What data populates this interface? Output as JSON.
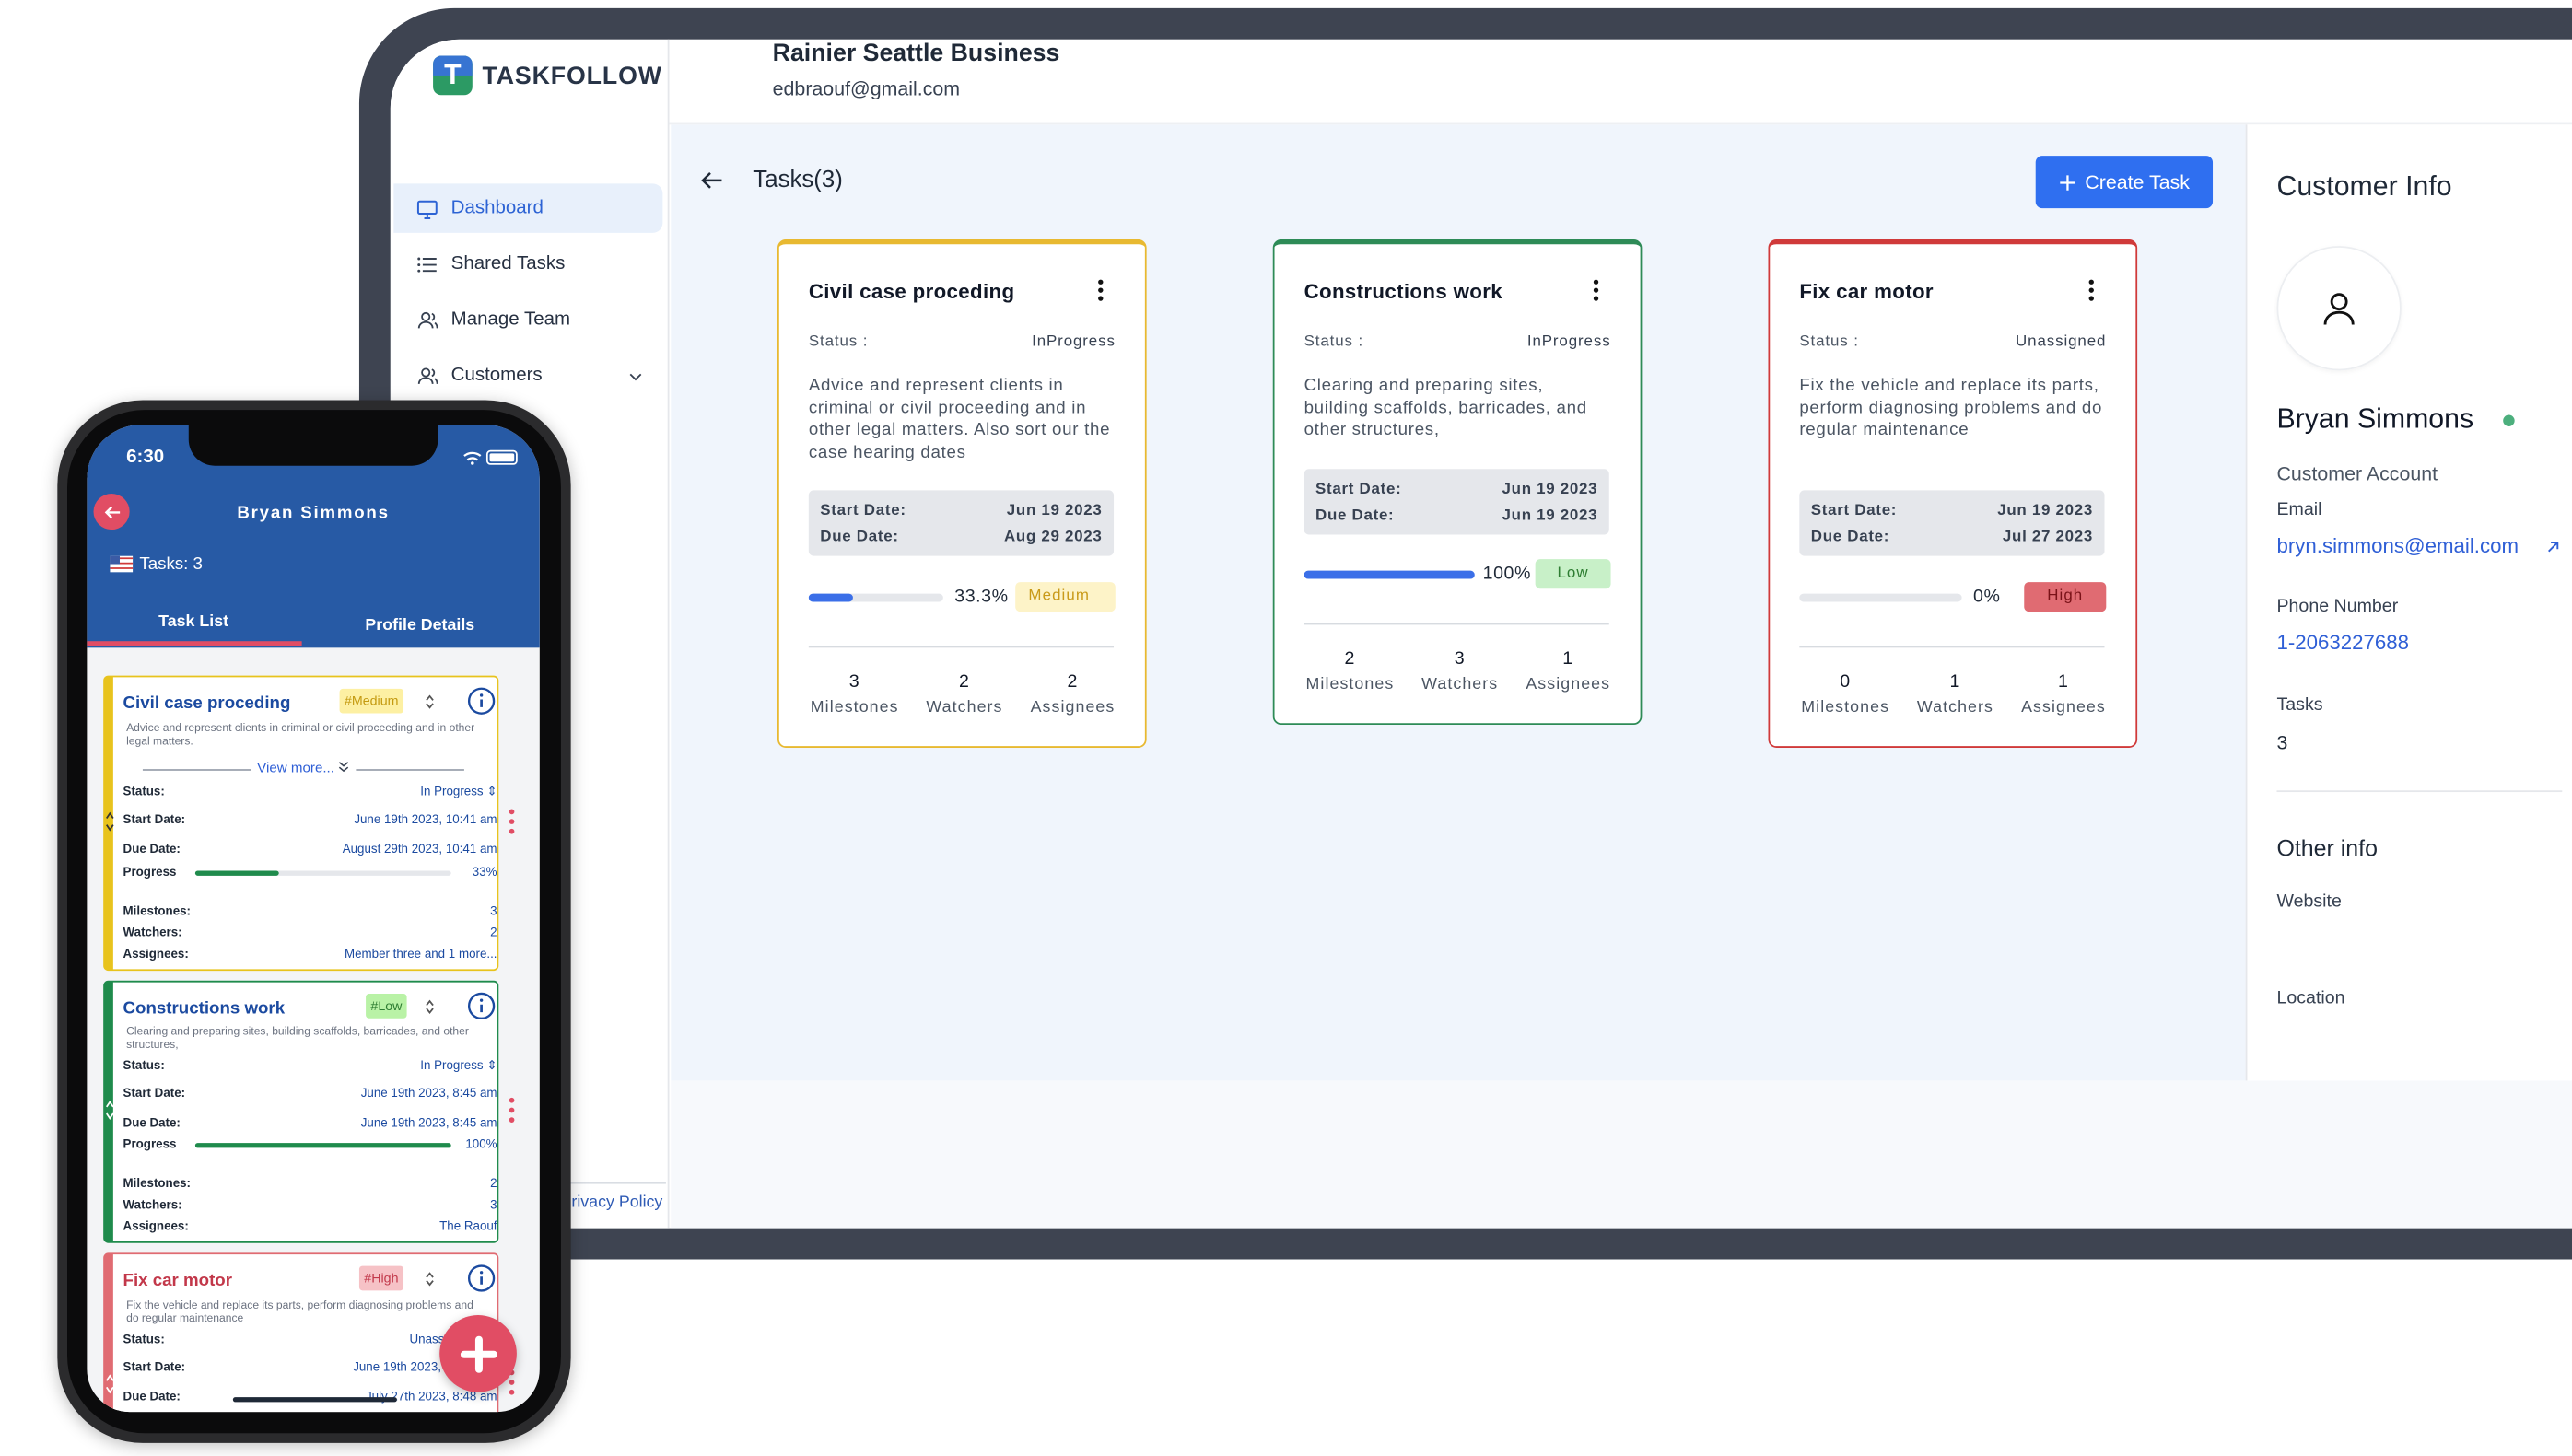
{
  "app": {
    "logo_text": "TASKFOLLOW",
    "business_name": "Rainier Seattle Business",
    "business_email": "edbraouf@gmail.com"
  },
  "sidebar": {
    "items": [
      {
        "label": "Dashboard",
        "icon": "monitor-icon",
        "active": true
      },
      {
        "label": "Shared Tasks",
        "icon": "list-icon"
      },
      {
        "label": "Manage Team",
        "icon": "users-icon"
      },
      {
        "label": "Customers",
        "icon": "users-icon",
        "has_chevron": true
      }
    ],
    "privacy_label": "Privacy Policy"
  },
  "main": {
    "title": "Tasks(3)",
    "create_label": "Create Task"
  },
  "tasks": [
    {
      "title": "Civil case proceding",
      "status_label": "Status :",
      "status": "InProgress",
      "description": "Advice and represent clients in criminal or civil proceeding and in other legal matters. Also sort our the case hearing dates",
      "start_label": "Start Date:",
      "start": "Jun 19 2023",
      "due_label": "Due Date:",
      "due": "Aug 29 2023",
      "progress": 33.3,
      "progress_text": "33.3%",
      "priority": "Medium",
      "milestones": "3",
      "watchers": "2",
      "assignees": "2",
      "milestones_label": "Milestones",
      "watchers_label": "Watchers",
      "assignees_label": "Assignees",
      "accent": "#e8b931"
    },
    {
      "title": "Constructions work",
      "status_label": "Status :",
      "status": "InProgress",
      "description": "Clearing and preparing sites, building scaffolds, barricades, and other structures,",
      "start_label": "Start Date:",
      "start": "Jun 19 2023",
      "due_label": "Due Date:",
      "due": "Jun 19 2023",
      "progress": 100,
      "progress_text": "100%",
      "priority": "Low",
      "milestones": "2",
      "watchers": "3",
      "assignees": "1",
      "milestones_label": "Milestones",
      "watchers_label": "Watchers",
      "assignees_label": "Assignees",
      "accent": "#2e8b57"
    },
    {
      "title": "Fix car motor",
      "status_label": "Status :",
      "status": "Unassigned",
      "description": "Fix the vehicle and replace its parts, perform diagnosing problems and do regular maintenance",
      "start_label": "Start Date:",
      "start": "Jun 19 2023",
      "due_label": "Due Date:",
      "due": "Jul 27 2023",
      "progress": 0,
      "progress_text": "0%",
      "priority": "High",
      "milestones": "0",
      "watchers": "1",
      "assignees": "1",
      "milestones_label": "Milestones",
      "watchers_label": "Watchers",
      "assignees_label": "Assignees",
      "accent": "#d03a3a"
    }
  ],
  "customer": {
    "title": "Customer Info",
    "name": "Bryan Simmons",
    "account_type": "Customer Account",
    "email_label": "Email",
    "email": "bryn.simmons@email.com",
    "phone_label": "Phone Number",
    "phone": "1-2063227688",
    "tasks_label": "Tasks",
    "tasks": "3",
    "other_title": "Other info",
    "website_label": "Website",
    "location_label": "Location"
  },
  "phone": {
    "time": "6:30",
    "name": "Bryan Simmons",
    "tasks_label": "Tasks: 3",
    "tabs": [
      "Task List",
      "Profile Details"
    ],
    "view_more": "View more...",
    "cards": [
      {
        "title": "Civil case proceding",
        "tag": "#Medium",
        "desc": "Advice and represent clients in criminal or civil proceeding and in other legal matters.",
        "status_label": "Status:",
        "status": "In Progress",
        "start_label": "Start Date:",
        "start": "June 19th 2023, 10:41 am",
        "due_label": "Due Date:",
        "due": "August 29th 2023, 10:41 am",
        "progress_label": "Progress",
        "progress": 33,
        "progress_text": "33%",
        "milestones_label": "Milestones:",
        "milestones": "3",
        "watchers_label": "Watchers:",
        "watchers": "2",
        "assignees_label": "Assignees:",
        "assignees": "Member three and 1 more..."
      },
      {
        "title": "Constructions work",
        "tag": "#Low",
        "desc": "Clearing and preparing sites, building scaffolds, barricades, and other structures,",
        "status_label": "Status:",
        "status": "In Progress",
        "start_label": "Start Date:",
        "start": "June 19th 2023, 8:45 am",
        "due_label": "Due Date:",
        "due": "June 19th 2023, 8:45 am",
        "progress_label": "Progress",
        "progress": 100,
        "progress_text": "100%",
        "milestones_label": "Milestones:",
        "milestones": "2",
        "watchers_label": "Watchers:",
        "watchers": "3",
        "assignees_label": "Assignees:",
        "assignees": "The Raouf"
      },
      {
        "title": "Fix car motor",
        "tag": "#High",
        "desc": "Fix the vehicle and replace its parts, perform diagnosing problems and do regular maintenance",
        "status_label": "Status:",
        "status": "Unassig...",
        "start_label": "Start Date:",
        "start": "June 19th 2023,",
        "due_label": "Due Date:",
        "due": "July 27th 2023, 8:48 am"
      }
    ]
  },
  "colors": {
    "brand_blue": "#2f6ff0",
    "phone_header": "#275aa5",
    "accent_red": "#e14d64",
    "medium_bg": "#fdf3c8",
    "medium_fg": "#c99a1a",
    "low_bg": "#c8f0c8",
    "low_fg": "#2e7d32",
    "high_bg": "#e06b72",
    "high_fg": "#7a1218"
  }
}
